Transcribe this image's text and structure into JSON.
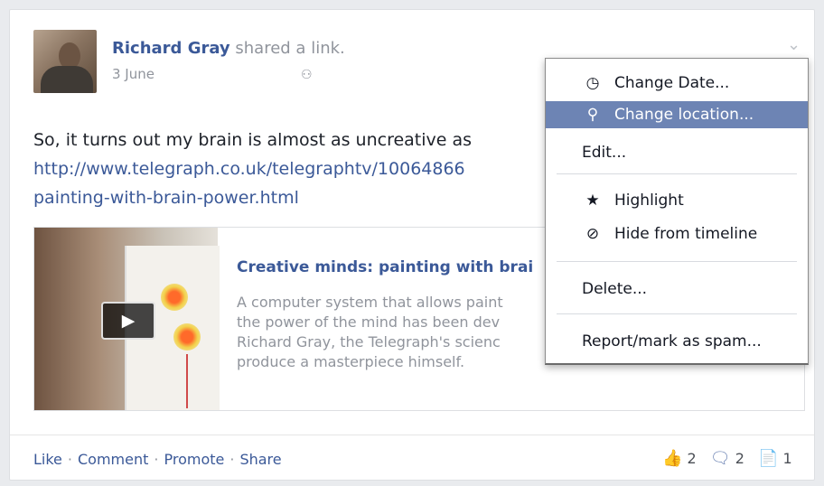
{
  "post": {
    "author": "Richard Gray",
    "action_text": " shared a link.",
    "date": "3 June",
    "audience_icon": "friends-icon",
    "text_line1": "So, it turns out my brain is almost as uncreative as",
    "link_line1": "http://www.telegraph.co.uk/telegraphtv/10064866",
    "link_line2": "painting-with-brain-power.html"
  },
  "attachment": {
    "title": "Creative minds: painting with brai",
    "desc_lines": [
      "A computer system that allows paint",
      "the power of the mind has been dev",
      "Richard Gray, the Telegraph's scienc",
      "produce a masterpiece himself."
    ],
    "play_icon": "▶"
  },
  "actions": {
    "like": "Like",
    "comment": "Comment",
    "promote": "Promote",
    "share": "Share",
    "separator": "·"
  },
  "counts": {
    "likes": "2",
    "comments": "2",
    "shares": "1"
  },
  "menu": {
    "items": [
      {
        "label": "Change Date...",
        "icon": "clock-icon",
        "glyph": "◷"
      },
      {
        "label": "Change location...",
        "icon": "location-pin-icon",
        "glyph": "⚲",
        "active": true
      },
      {
        "label": "Edit..."
      },
      {
        "label": "Highlight",
        "icon": "star-icon",
        "glyph": "★"
      },
      {
        "label": "Hide from timeline",
        "icon": "hide-icon",
        "glyph": "⊘"
      },
      {
        "label": "Delete..."
      },
      {
        "label": "Report/mark as spam..."
      }
    ]
  },
  "colors": {
    "link": "#3b5998",
    "menu_active": "#6d84b4",
    "muted": "#90949c"
  }
}
